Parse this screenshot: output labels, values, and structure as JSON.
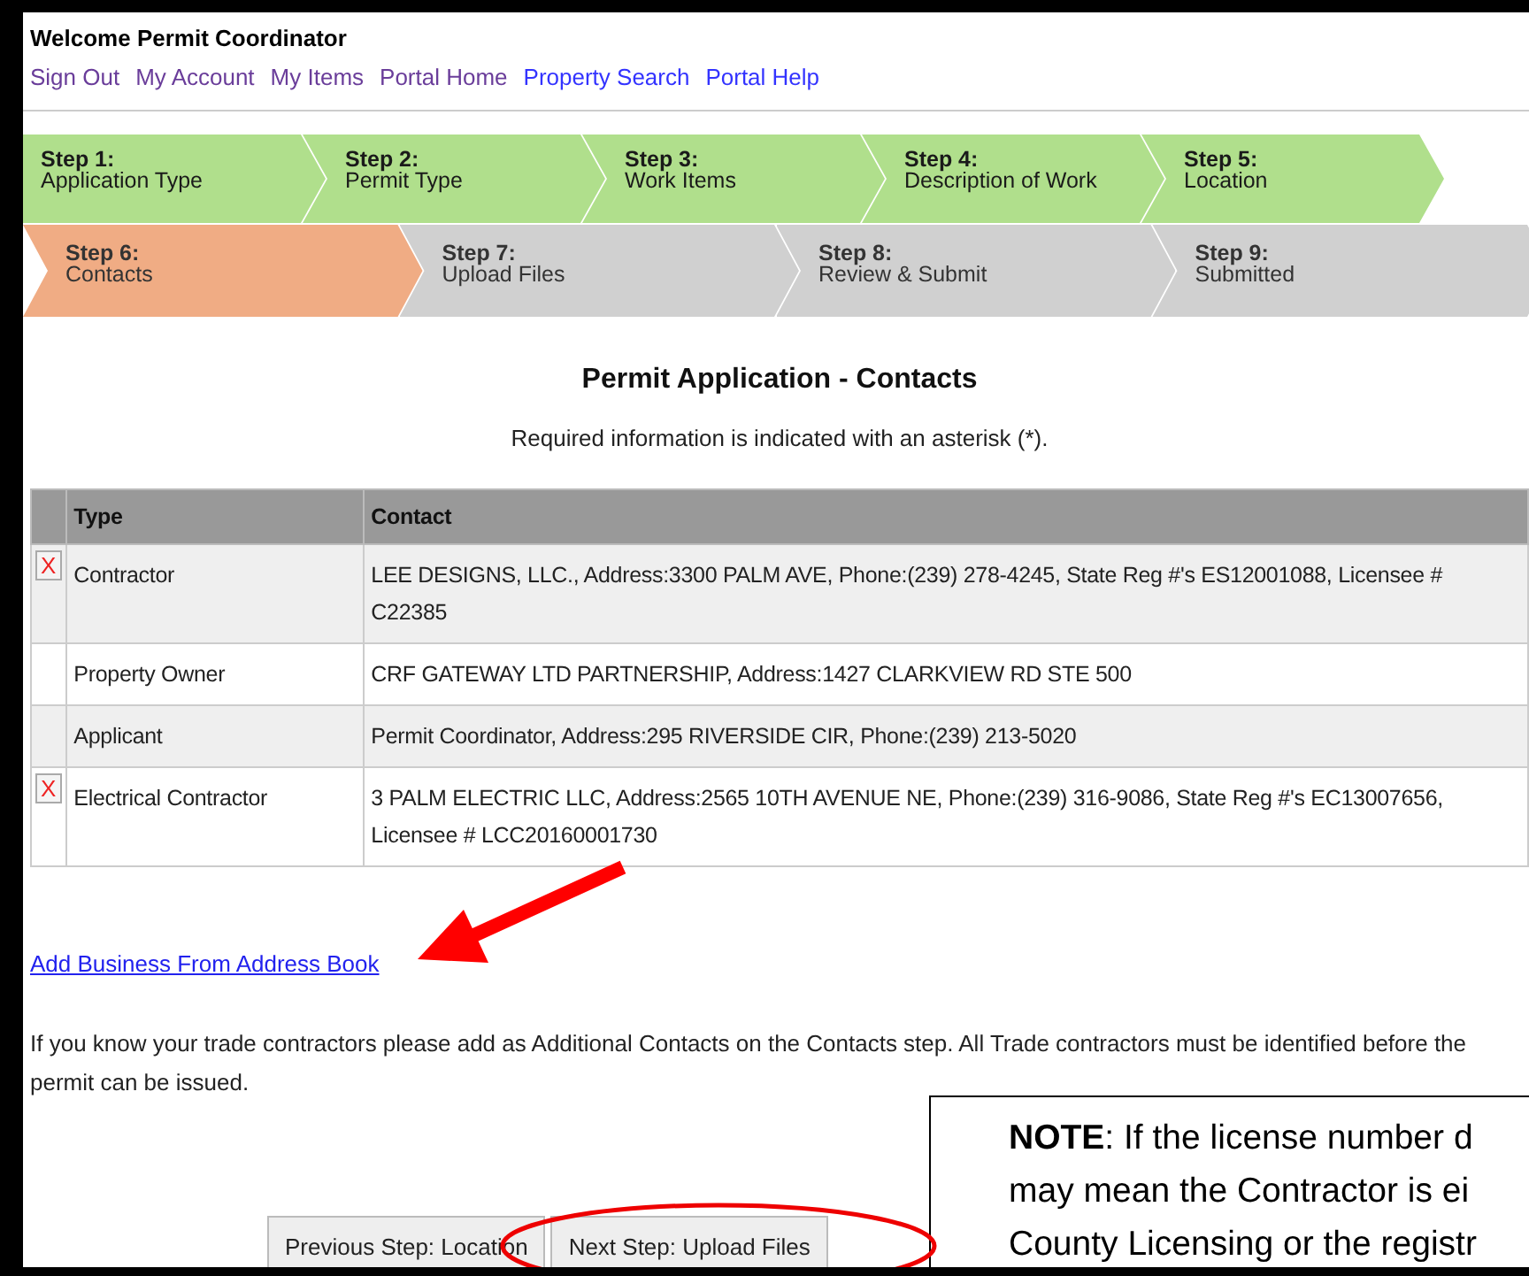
{
  "header": {
    "welcome": "Welcome Permit Coordinator",
    "links": [
      {
        "label": "Sign Out",
        "visited": true
      },
      {
        "label": "My Account",
        "visited": true
      },
      {
        "label": "My Items",
        "visited": true
      },
      {
        "label": "Portal Home",
        "visited": true
      },
      {
        "label": "Property Search",
        "visited": false
      },
      {
        "label": "Portal Help",
        "visited": false
      }
    ]
  },
  "steps": [
    [
      {
        "number": "Step 1:",
        "label": "Application Type",
        "completed": true,
        "selected": false
      },
      {
        "number": "Step 2:",
        "label": "Permit Type",
        "completed": true,
        "selected": false
      },
      {
        "number": "Step 3:",
        "label": "Work Items",
        "completed": true,
        "selected": false
      },
      {
        "number": "Step 4:",
        "label": "Description of Work",
        "completed": true,
        "selected": false
      },
      {
        "number": "Step 5:",
        "label": "Location",
        "completed": true,
        "selected": false
      }
    ],
    [
      {
        "number": "Step 6:",
        "label": "Contacts",
        "completed": false,
        "selected": true
      },
      {
        "number": "Step 7:",
        "label": "Upload Files",
        "completed": false,
        "selected": false
      },
      {
        "number": "Step 8:",
        "label": "Review & Submit",
        "completed": false,
        "selected": false
      },
      {
        "number": "Step 9:",
        "label": "Submitted",
        "completed": false,
        "selected": false
      }
    ]
  ],
  "title": "Permit Application - Contacts",
  "required_note": "Required information is indicated with an asterisk (*).",
  "table": {
    "columns": [
      "Type",
      "Contact"
    ],
    "rows": [
      {
        "remove": "X",
        "type": "Contractor",
        "contact": "LEE DESIGNS, LLC., Address:3300 PALM AVE, Phone:(239) 278-4245, State Reg #'s ES12001088, Licensee # C22385"
      },
      {
        "type": "Property Owner",
        "contact": "CRF GATEWAY LTD PARTNERSHIP, Address:1427 CLARKVIEW RD STE 500"
      },
      {
        "type": "Applicant",
        "contact": "Permit Coordinator, Address:295 RIVERSIDE CIR, Phone:(239) 213-5020"
      },
      {
        "remove": "X",
        "type": "Electrical Contractor",
        "contact": "3 PALM ELECTRIC LLC, Address:2565 10TH AVENUE NE, Phone:(239) 316-9086, State Reg #'s EC13007656, Licensee # LCC20160001730"
      }
    ]
  },
  "add_link": "Add Business From Address Book",
  "info": "If you know your trade contractors please add as Additional Contacts on the Contacts step. All Trade contractors must be identified before the permit can be issued.",
  "buttons": [
    "Previous Step: Location",
    "Next Step: Upload Files"
  ],
  "note": [
    "**NOTE**: If the license number d",
    "may mean the Contractor is ei",
    "County Licensing or the registr"
  ]
}
